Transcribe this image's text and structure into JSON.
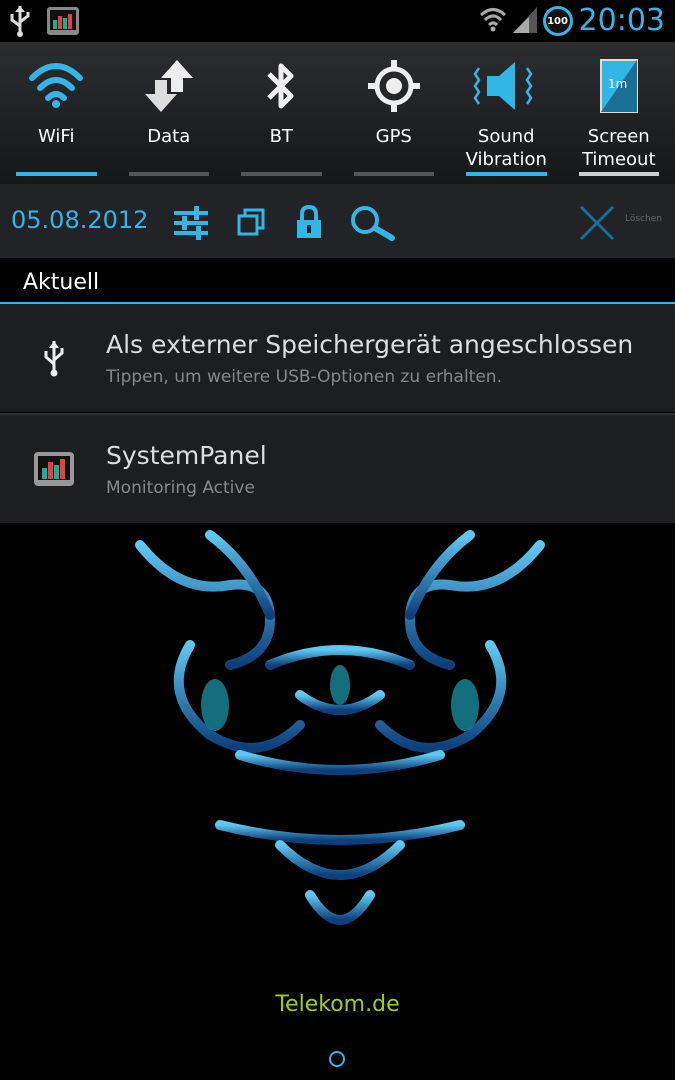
{
  "status_bar": {
    "time": "20:03",
    "battery": "100",
    "icons": [
      "usb-icon",
      "systempanel-icon",
      "wifi-icon",
      "signal-icon",
      "battery-icon"
    ]
  },
  "toggles": [
    {
      "label": "WiFi",
      "icon": "wifi-icon",
      "active": true
    },
    {
      "label": "Data",
      "icon": "data-icon",
      "active": false
    },
    {
      "label": "BT",
      "icon": "bluetooth-icon",
      "active": false
    },
    {
      "label": "GPS",
      "icon": "gps-icon",
      "active": false
    },
    {
      "label": "Sound\nVibration",
      "icon": "sound-icon",
      "active": true
    },
    {
      "label": "Screen\nTimeout",
      "icon": "screen-timeout-icon",
      "active": false
    }
  ],
  "toolbar": {
    "date": "05.08.2012",
    "tools": [
      "settings-icon",
      "recent-apps-icon",
      "lock-icon",
      "search-icon"
    ],
    "clear_label": "Löschen"
  },
  "section": {
    "title": "Aktuell"
  },
  "notifications": [
    {
      "title": "Als externer Speichergerät angeschlossen",
      "subtitle": "Tippen, um weitere USB-Optionen zu erhalten.",
      "icon": "usb-icon"
    },
    {
      "title": "SystemPanel",
      "subtitle": "Monitoring Active",
      "icon": "systempanel-icon"
    }
  ],
  "carrier": "Telekom.de",
  "colors": {
    "accent": "#33b5e5",
    "carrier": "#9ccc2a"
  }
}
